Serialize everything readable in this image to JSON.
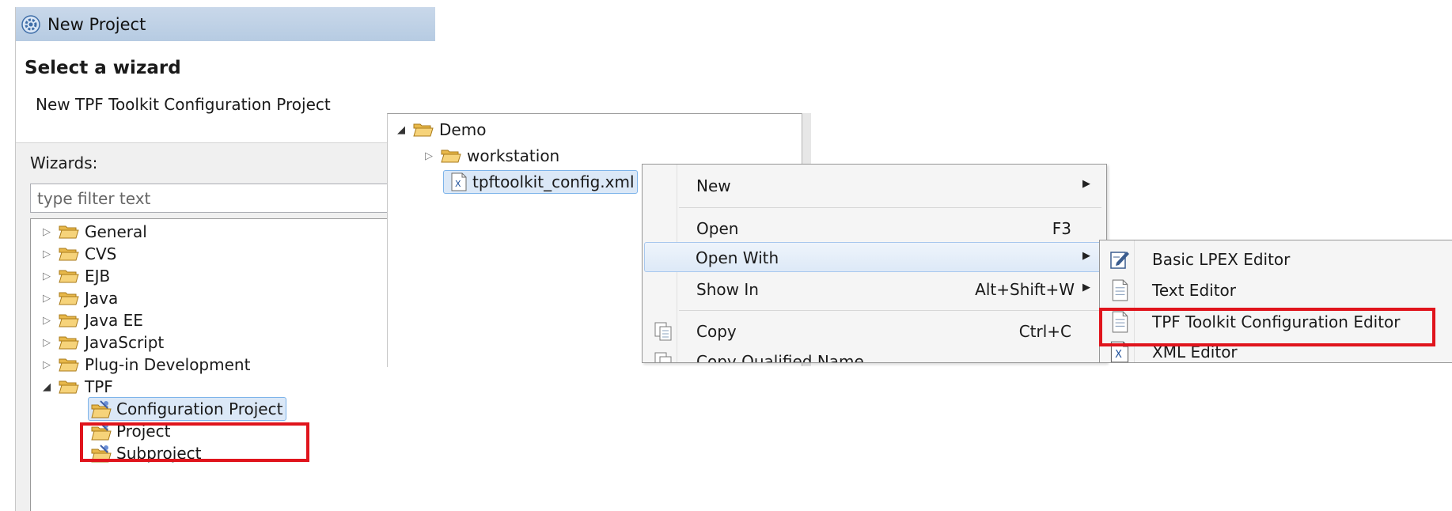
{
  "wizard": {
    "title": "New Project",
    "heading": "Select a wizard",
    "description": "New TPF Toolkit Configuration Project",
    "wizards_label": "Wizards:",
    "filter_placeholder": "type filter text",
    "tree": [
      {
        "label": "General",
        "expanded": false
      },
      {
        "label": "CVS",
        "expanded": false
      },
      {
        "label": "EJB",
        "expanded": false
      },
      {
        "label": "Java",
        "expanded": false
      },
      {
        "label": "Java EE",
        "expanded": false
      },
      {
        "label": "JavaScript",
        "expanded": false
      },
      {
        "label": "Plug-in Development",
        "expanded": false
      },
      {
        "label": "TPF",
        "expanded": true,
        "children": [
          "Configuration Project",
          "Project",
          "Subproject"
        ],
        "selected_child": "Configuration Project"
      }
    ]
  },
  "explorer": {
    "root": "Demo",
    "children": [
      "workstation",
      "tpftoolkit_config.xml"
    ],
    "selected": "tpftoolkit_config.xml"
  },
  "context_menu": {
    "items": [
      {
        "label": "New",
        "shortcut": "",
        "submenu": true
      },
      {
        "label": "Open",
        "shortcut": "F3",
        "submenu": false
      },
      {
        "label": "Open With",
        "shortcut": "",
        "submenu": true,
        "highlighted": true
      },
      {
        "label": "Show In",
        "shortcut": "Alt+Shift+W",
        "submenu": true
      },
      {
        "label": "Copy",
        "shortcut": "Ctrl+C",
        "submenu": false
      },
      {
        "label": "Copy Qualified Name",
        "shortcut": "",
        "submenu": false
      }
    ]
  },
  "open_with_menu": {
    "items": [
      {
        "label": "Basic LPEX Editor",
        "icon": "lpex-editor-icon"
      },
      {
        "label": "Text Editor",
        "icon": "text-editor-icon"
      },
      {
        "label": "TPF Toolkit Configuration Editor",
        "icon": "tpf-config-editor-icon",
        "highlighted": true
      },
      {
        "label": "XML Editor",
        "icon": "xml-editor-icon"
      }
    ]
  },
  "colors": {
    "highlight_box": "#e0141c",
    "selection_fill": "#dbe8f7",
    "selection_border": "#7eb4ea",
    "titlebar": "#c0d2e7"
  }
}
